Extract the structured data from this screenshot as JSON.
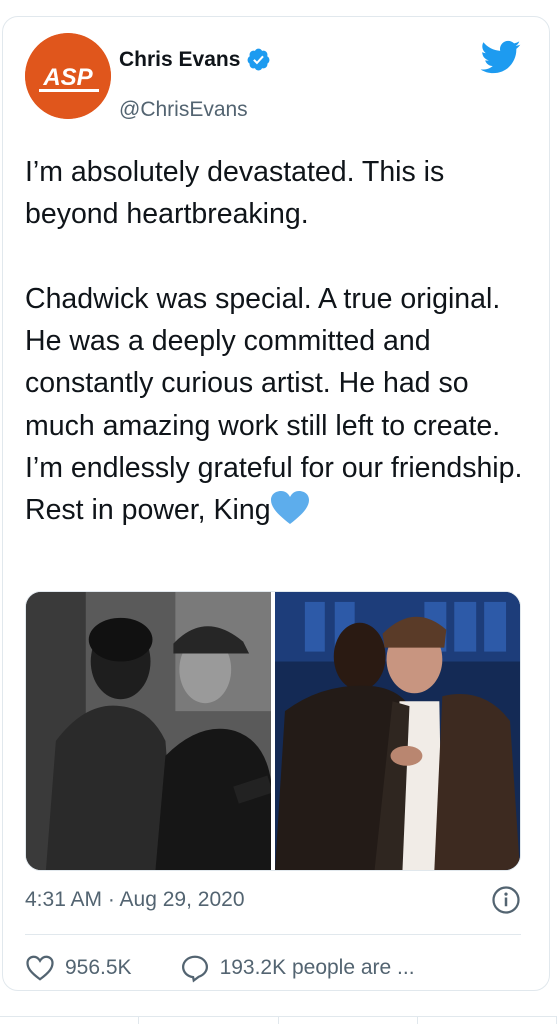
{
  "user": {
    "display_name": "Chris Evans",
    "handle": "@ChrisEvans",
    "avatar_text": "ASP",
    "verified": true,
    "verified_color": "#1d9bf0"
  },
  "tweet": {
    "text": "I’m absolutely devastated. This is beyond heartbreaking.\n\nChadwick was special. A true original. He was a deeply committed and constantly curious artist. He had so much amazing work still left to create. I’m endlessly grateful for our friendship. Rest in power, King",
    "emoji": "blue-heart-emoji",
    "timestamp": "4:31 AM · Aug 29, 2020"
  },
  "media": {
    "count": 2,
    "left_photo": "black-and-white-photo",
    "right_photo": "color-photo"
  },
  "actions": {
    "likes": "956.5K",
    "replies": "193.2K people are ..."
  },
  "icons": {
    "brand": "twitter-bird-icon",
    "info": "info-icon",
    "like": "heart-outline-icon",
    "reply": "speech-bubble-icon"
  },
  "colors": {
    "twitter_blue": "#1d9bf0",
    "avatar_bg": "#e0561c",
    "secondary_text": "#536471"
  }
}
